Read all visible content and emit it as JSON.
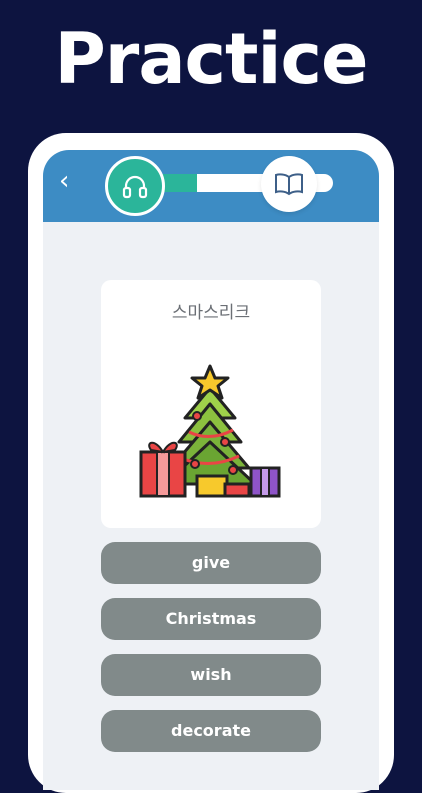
{
  "headline": "Practice",
  "nav": {
    "back_label": "‹"
  },
  "progress": {
    "fraction": 0.35
  },
  "card": {
    "word": "스마스리크"
  },
  "options": [
    {
      "label": "give"
    },
    {
      "label": "Christmas"
    },
    {
      "label": "wish"
    },
    {
      "label": "decorate"
    }
  ],
  "colors": {
    "background": "#0d1440",
    "topbar": "#3d8cc4",
    "accent": "#2bb59a",
    "option": "#818a8a"
  },
  "icons": {
    "step_start": "headphones-icon",
    "step_end": "open-book-icon",
    "illustration": "christmas-tree-icon"
  }
}
